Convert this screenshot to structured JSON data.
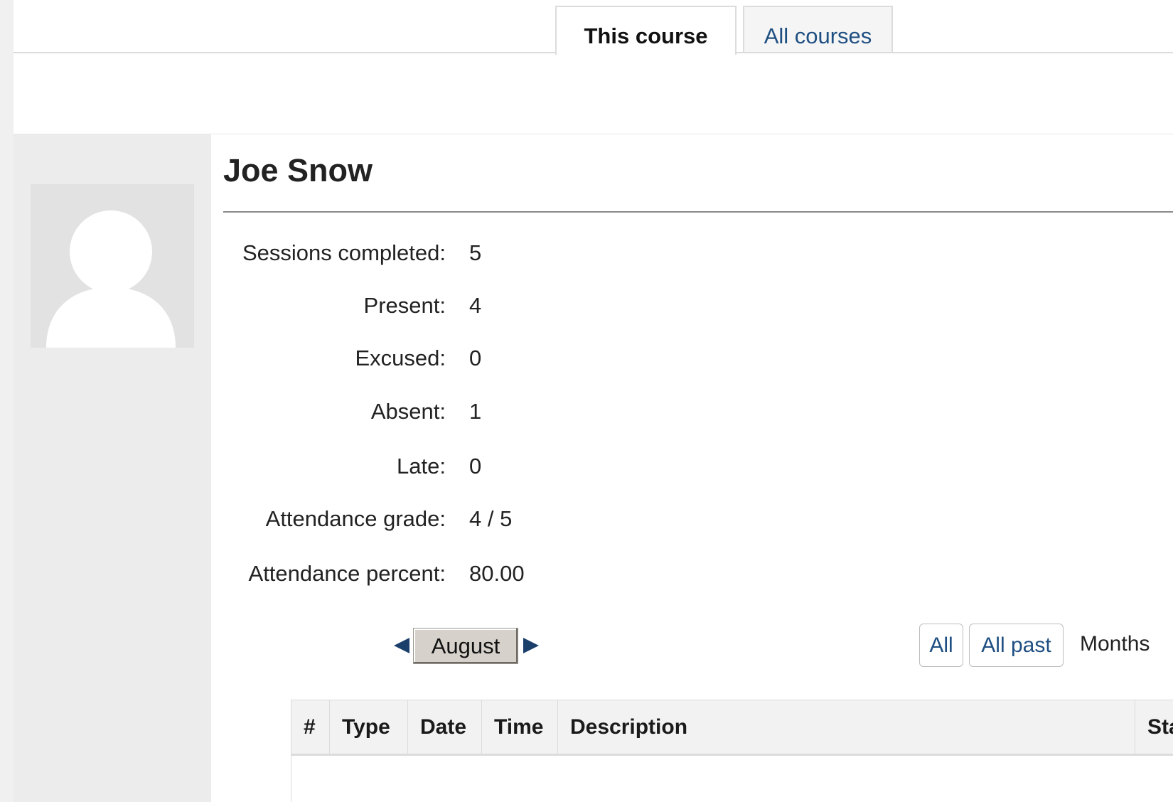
{
  "tabs": [
    {
      "label": "This course",
      "active": true
    },
    {
      "label": "All courses",
      "active": false
    }
  ],
  "user": {
    "name": "Joe Snow",
    "avatar_icon": "user-silhouette-icon"
  },
  "stats": [
    {
      "label": "Sessions completed:",
      "value": "5"
    },
    {
      "label": "Present:",
      "value": "4"
    },
    {
      "label": "Excused:",
      "value": "0"
    },
    {
      "label": "Absent:",
      "value": "1"
    },
    {
      "label": "Late:",
      "value": "0"
    },
    {
      "label": "Attendance grade:",
      "value": "4 / 5"
    },
    {
      "label": "Attendance percent:",
      "value": "80.00"
    }
  ],
  "month_nav": {
    "current_month": "August",
    "prev_icon": "triangle-left-icon",
    "next_icon": "triangle-right-icon"
  },
  "filters": {
    "all_label": "All",
    "all_past_label": "All past",
    "months_label": "Months"
  },
  "table": {
    "columns": [
      "#",
      "Type",
      "Date",
      "Time",
      "Description",
      "Sta"
    ]
  },
  "colors": {
    "link": "#1f4f82",
    "nav_arrow": "#1b3f6b",
    "sidebar_bg": "#ececec"
  }
}
